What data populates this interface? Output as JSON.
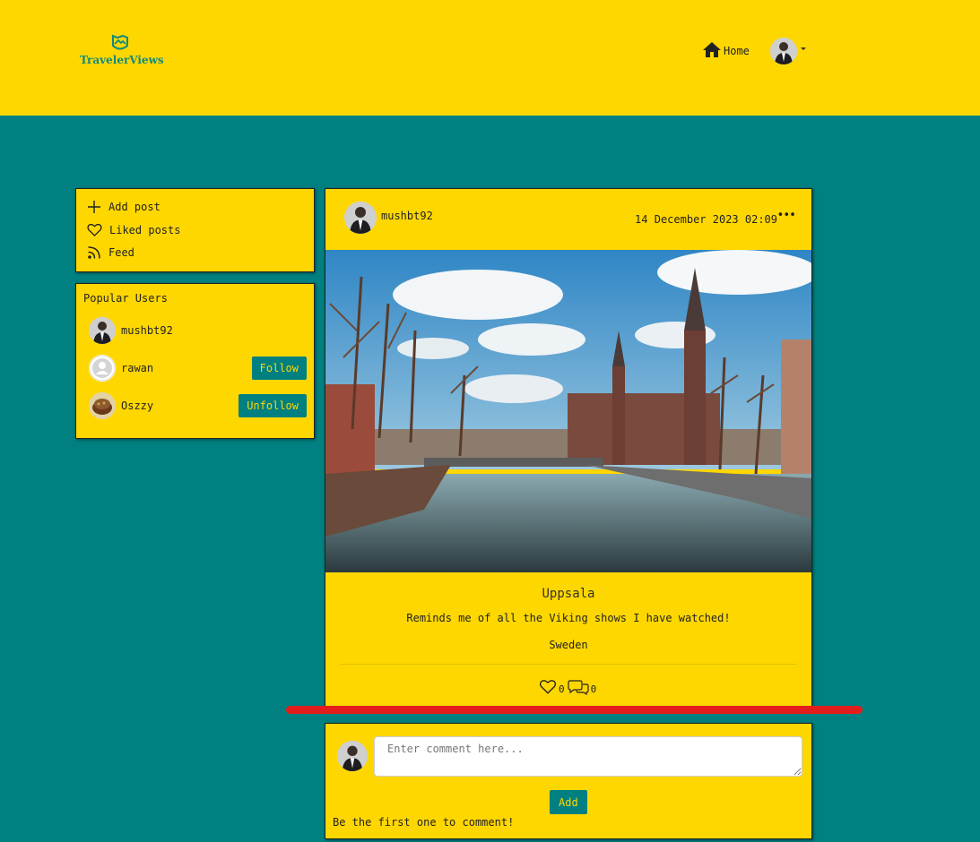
{
  "brand": {
    "name": "TravelerViews",
    "icon": "map-shield-logo"
  },
  "nav": {
    "home_label": "Home",
    "home_icon": "home-icon",
    "profile_icon": "user-avatar"
  },
  "menu": {
    "items": [
      {
        "label": "Add post",
        "icon": "plus-icon"
      },
      {
        "label": "Liked posts",
        "icon": "heart-icon"
      },
      {
        "label": "Feed",
        "icon": "rss-icon"
      }
    ]
  },
  "popular": {
    "title": "Popular Users",
    "users": [
      {
        "name": "mushbt92",
        "action": ""
      },
      {
        "name": "rawan",
        "action": "Follow"
      },
      {
        "name": "Oszzy",
        "action": "Unfollow"
      }
    ]
  },
  "post": {
    "author": "mushbt92",
    "date": "14 December 2023 02:09",
    "more": "•••",
    "title": "Uppsala",
    "description": "Reminds me of all the Viking shows I have watched!",
    "location": "Sweden",
    "likes": "0",
    "comments": "0"
  },
  "comment_form": {
    "placeholder": "Enter comment here...",
    "add_label": "Add",
    "empty_message": "Be the first one to comment!"
  },
  "colors": {
    "primary": "#FFD700",
    "background": "#008080",
    "annotation": "#e31c1c"
  }
}
